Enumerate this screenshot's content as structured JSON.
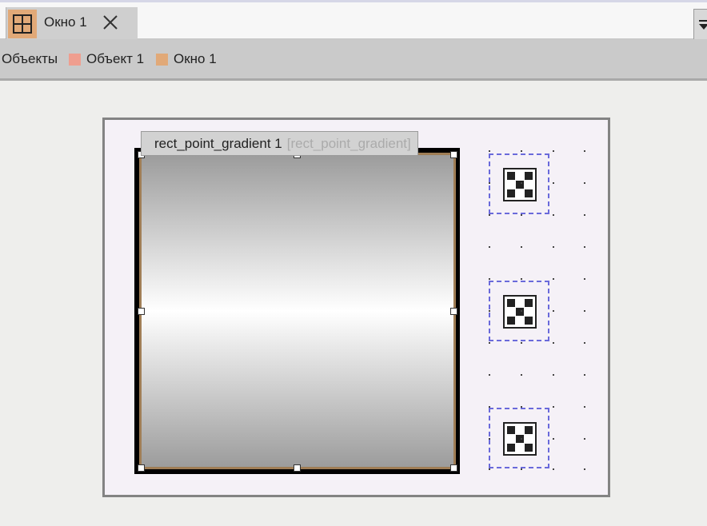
{
  "tab": {
    "label": "Окно 1",
    "icon": "window-grid-icon",
    "close_icon": "close-icon"
  },
  "overflow": {
    "icon": "tab-overflow-icon"
  },
  "breadcrumb": {
    "items": [
      {
        "label": "Объекты",
        "swatch": ""
      },
      {
        "label": "Объект 1",
        "swatch": "#ef9e8f"
      },
      {
        "label": "Окно 1",
        "swatch": "#e1a978"
      }
    ]
  },
  "widget": {
    "name": "rect_point_gradient 1",
    "type": "[rect_point_gradient]",
    "border_color": "#9f7d55"
  },
  "slots": [
    {
      "icon": "grid-pattern-icon"
    },
    {
      "icon": "grid-pattern-icon"
    },
    {
      "icon": "grid-pattern-icon"
    }
  ],
  "colors": {
    "slot_border": "#6a6adb",
    "canvas_bg": "#f5f1f7",
    "canvas_border": "#838383"
  }
}
